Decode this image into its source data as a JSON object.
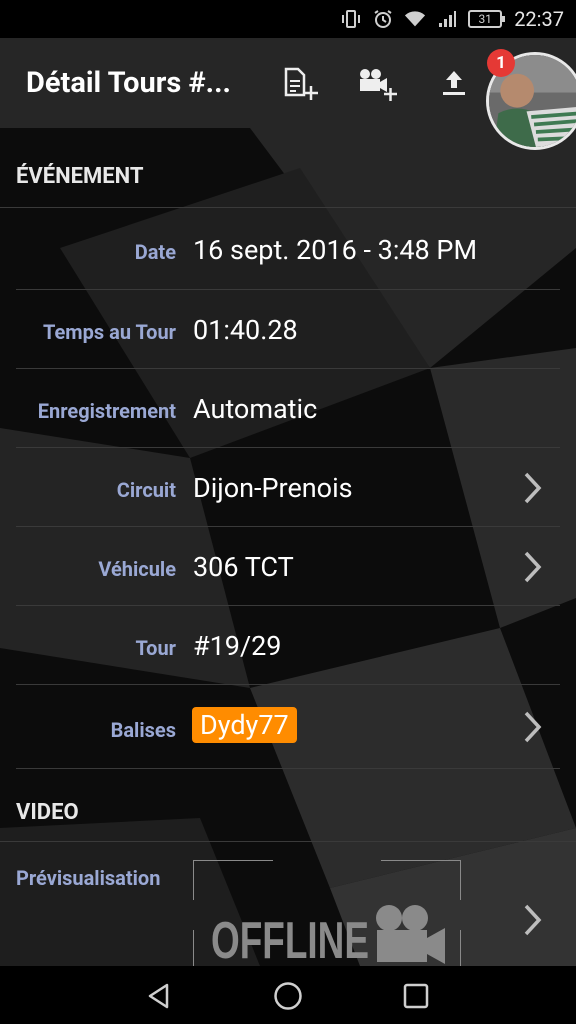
{
  "statusbar": {
    "battery": "31",
    "time": "22:37",
    "icons": [
      "vibrate-icon",
      "alarm-icon",
      "wifi-icon",
      "signal-icon",
      "battery-icon"
    ]
  },
  "appbar": {
    "title": "Détail Tours #...",
    "actions": [
      "add-document-icon",
      "add-video-icon",
      "upload-icon"
    ],
    "badge_count": "1"
  },
  "event_section": {
    "title": "ÉVÉNEMENT",
    "rows": [
      {
        "label": "Date",
        "value": "16 sept. 2016 - 3:48 PM"
      },
      {
        "label": "Temps au Tour",
        "value": "01:40.28"
      },
      {
        "label": "Enregistrement",
        "value": "Automatic"
      },
      {
        "label": "Circuit",
        "value": "Dijon-Prenois"
      },
      {
        "label": "Véhicule",
        "value": "306 TCT"
      },
      {
        "label": "Tour",
        "value": "#19/29"
      },
      {
        "label": "Balises",
        "value": "Dydy77"
      }
    ]
  },
  "video_section": {
    "title": "VIDEO",
    "preview_label": "Prévisualisation",
    "offline_text": "OFFLINE"
  },
  "colors": {
    "accent_tag": "#ff8c00",
    "label": "#9aa8d4",
    "badge": "#e53935"
  }
}
